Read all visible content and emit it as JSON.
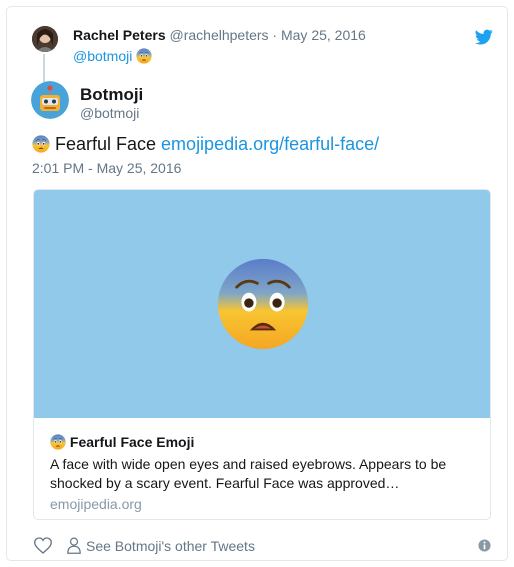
{
  "reply": {
    "name": "Rachel Peters",
    "meta": " @rachelhpeters · May 25, 2016",
    "text": "@botmoji "
  },
  "author": {
    "name": "Botmoji",
    "handle": "@botmoji"
  },
  "tweet": {
    "text": " Fearful Face ",
    "link": "emojipedia.org/fearful-face/",
    "time": "2:01 PM - May 25, 2016"
  },
  "link_card": {
    "title": " Fearful Face Emoji",
    "description": "A face with wide open eyes and raised eyebrows. Appears to be shocked by a scary event. Fearful Face was approved…",
    "domain": "emojipedia.org"
  },
  "footer": {
    "other_tweets_label": "See Botmoji's other Tweets"
  },
  "colors": {
    "accent": "#1b95e0",
    "image_bg": "#90c9ea"
  },
  "icons": [
    "twitter-bird-icon",
    "heart-icon",
    "person-icon",
    "info-icon",
    "fearful-face-emoji"
  ]
}
